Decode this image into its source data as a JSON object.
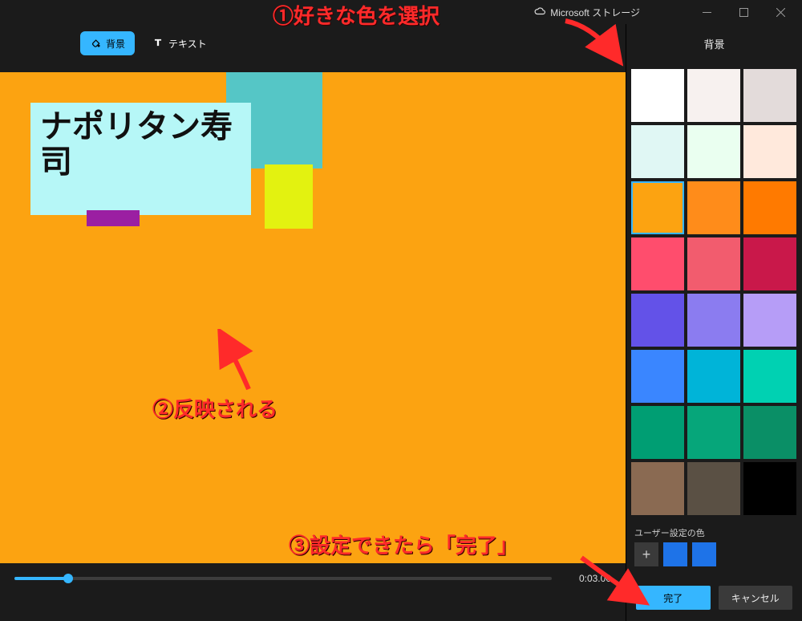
{
  "titlebar": {
    "storage_label": "Microsoft ストレージ"
  },
  "toolbar": {
    "bg_label": "背景",
    "text_label": "テキスト"
  },
  "canvas": {
    "bg_color": "#fca311",
    "panel_text": "ナポリタン寿司"
  },
  "timeline": {
    "time": "0:03.00",
    "progress_pct": 10
  },
  "sidebar": {
    "title": "背景",
    "rows": [
      [
        "#ffffff",
        "#f7f1ef",
        "#e3dbda"
      ],
      [
        "#e0f7f4",
        "#eafff0",
        "#ffe9dc"
      ],
      [
        "#fca311",
        "#ff8c1a",
        "#ff7a00"
      ],
      [
        "#ff4d6d",
        "#f25c6e",
        "#c9184a"
      ],
      [
        "#6352e8",
        "#8b7cf0",
        "#b69df7"
      ],
      [
        "#3a86ff",
        "#00b4d8",
        "#00d1b2"
      ],
      [
        "#009e73",
        "#06a67a",
        "#0a8f66"
      ],
      [
        "#8a6a52",
        "#5a5044",
        "#000000"
      ]
    ],
    "selected": [
      2,
      0
    ],
    "user_colors_label": "ユーザー設定の色",
    "user_colors": [
      "#1e73e8",
      "#1e73e8"
    ],
    "done_label": "完了",
    "cancel_label": "キャンセル"
  },
  "annotations": {
    "a1": "①好きな色を選択",
    "a2": "②反映される",
    "a3": "③設定できたら「完了」"
  }
}
